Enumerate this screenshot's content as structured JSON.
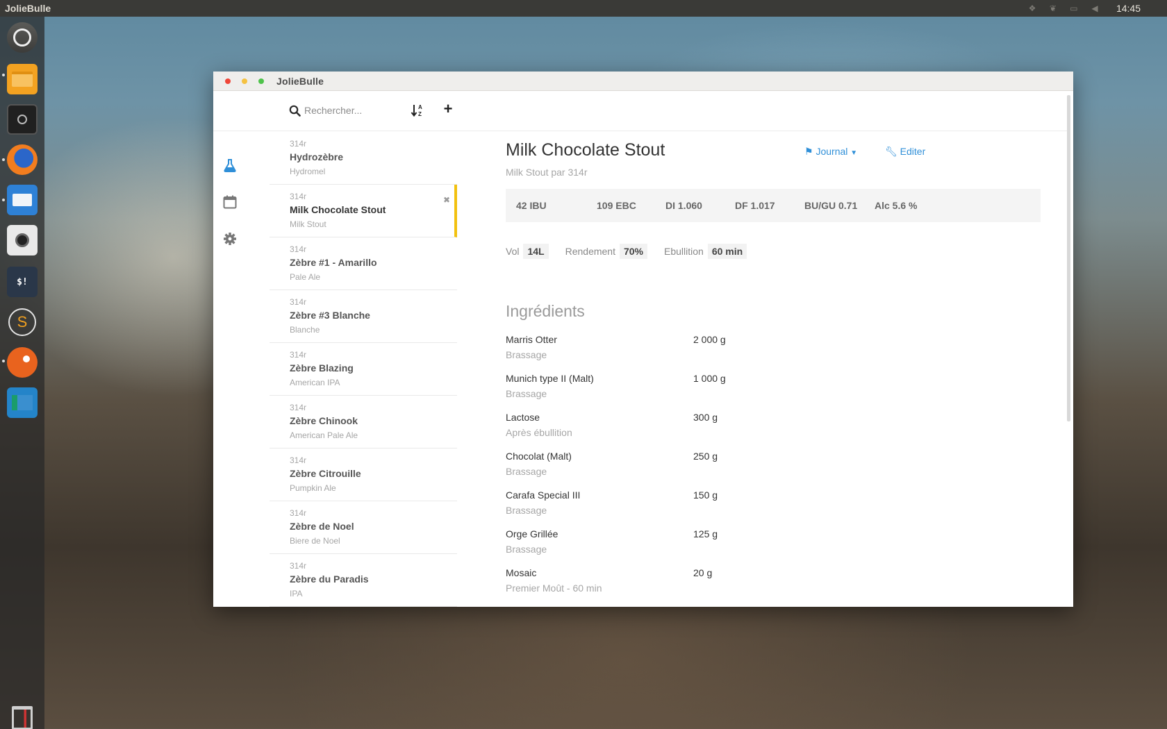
{
  "topbar": {
    "app_title": "JolieBulle",
    "clock": "14:45",
    "indicators": [
      "dropbox-icon",
      "leaf-icon",
      "chat-icon",
      "volume-icon"
    ]
  },
  "launcher": {
    "apps": [
      "ubuntu-dash",
      "files",
      "keepass",
      "firefox",
      "mail",
      "camera",
      "terminal",
      "sublime-text",
      "orange-app",
      "blue-app",
      "trash"
    ]
  },
  "window": {
    "title": "JolieBulle"
  },
  "toolbar": {
    "search_placeholder": "Rechercher...",
    "sort_label": "↓A Z",
    "add_label": "+"
  },
  "nav": {
    "items": [
      "recipes-flask-icon",
      "calendar-icon",
      "settings-gear-icon"
    ],
    "accent": "#2f8fd8"
  },
  "recipes": [
    {
      "author": "314r",
      "name": "Hydrozèbre",
      "style": "Hydromel"
    },
    {
      "author": "314r",
      "name": "Milk Chocolate Stout",
      "style": "Milk Stout",
      "remove": "✖"
    },
    {
      "author": "314r",
      "name": "Zèbre #1 - Amarillo",
      "style": "Pale Ale"
    },
    {
      "author": "314r",
      "name": "Zèbre #3 Blanche",
      "style": "Blanche"
    },
    {
      "author": "314r",
      "name": "Zèbre Blazing",
      "style": "American IPA"
    },
    {
      "author": "314r",
      "name": "Zèbre Chinook",
      "style": "American Pale Ale"
    },
    {
      "author": "314r",
      "name": "Zèbre Citrouille",
      "style": "Pumpkin Ale"
    },
    {
      "author": "314r",
      "name": "Zèbre de Noel",
      "style": "Biere de Noel"
    },
    {
      "author": "314r",
      "name": "Zèbre du Paradis",
      "style": "IPA"
    }
  ],
  "detail": {
    "title": "Milk Chocolate Stout",
    "subtitle": "Milk Stout par 314r",
    "journal_label": "Journal",
    "edit_label": "Editer",
    "stats": {
      "ibu": "42 IBU",
      "ebc": "109 EBC",
      "di": "DI 1.060",
      "df": "DF 1.017",
      "bugu": "BU/GU 0.71",
      "alc": "Alc 5.6 %"
    },
    "params": {
      "vol_label": "Vol",
      "vol_value": "14L",
      "yield_label": "Rendement",
      "yield_value": "70%",
      "boil_label": "Ebullition",
      "boil_value": "60 min"
    },
    "ingredients_title": "Ingrédients",
    "ingredients": [
      {
        "name": "Marris Otter",
        "step": "Brassage",
        "qty": "2 000 g"
      },
      {
        "name": "Munich type II (Malt)",
        "step": "Brassage",
        "qty": "1 000 g"
      },
      {
        "name": "Lactose",
        "step": "Après ébullition",
        "qty": "300 g"
      },
      {
        "name": "Chocolat (Malt)",
        "step": "Brassage",
        "qty": "250 g"
      },
      {
        "name": "Carafa Special III",
        "step": "Brassage",
        "qty": "150 g"
      },
      {
        "name": "Orge Grillée",
        "step": "Brassage",
        "qty": "125 g"
      },
      {
        "name": "Mosaic",
        "step": "Premier Moût - 60 min",
        "qty": "20 g"
      }
    ]
  }
}
